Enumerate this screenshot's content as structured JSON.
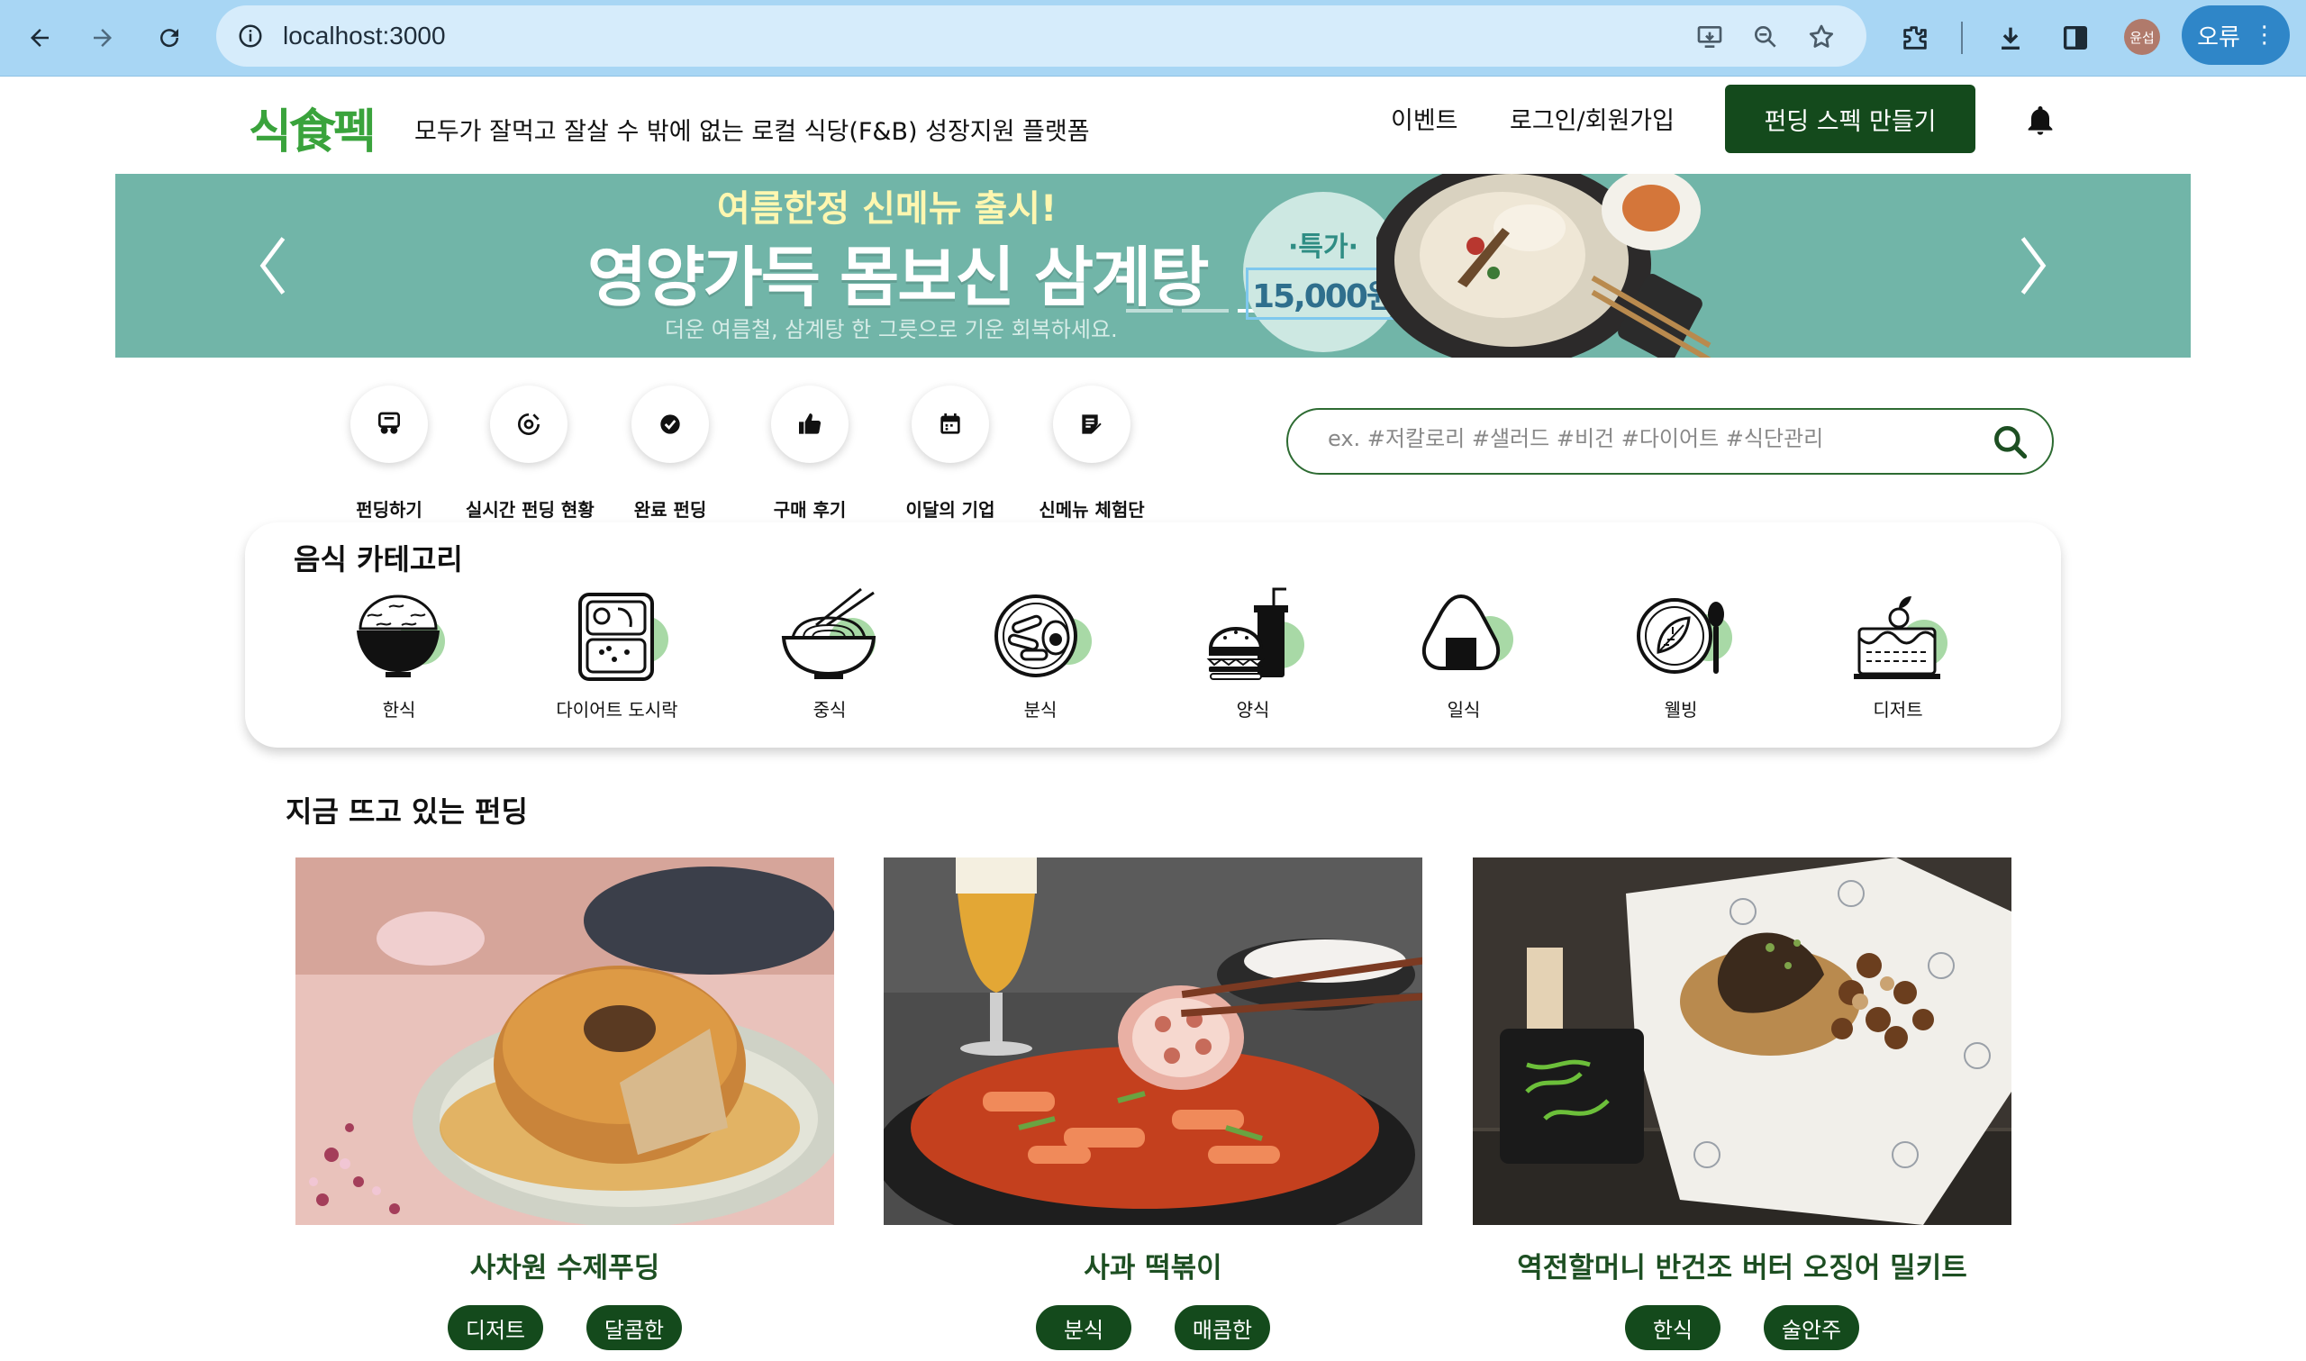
{
  "browser": {
    "url": "localhost:3000",
    "profile_initials": "윤섭",
    "error_label": "오류"
  },
  "header": {
    "logo": "식食펙",
    "tagline": "모두가 잘먹고 잘살 수 밖에 없는 로컬 식당(F&B) 성장지원 플랫폼",
    "nav": [
      "이벤트",
      "로그인/회원가입"
    ],
    "cta": "펀딩 스펙 만들기"
  },
  "banner": {
    "kicker": "여름한정 신메뉴 출시!",
    "title": "영양가득 몸보신 삼계탕",
    "subtitle": "더운 여름철, 삼계탕 한 그릇으로 기운 회복하세요.",
    "price_label": "·특가·",
    "price": "15,000원",
    "active_slide": 3,
    "slide_count": 3
  },
  "quick_menu": [
    {
      "label": "펀딩하기",
      "icon": "funding-icon"
    },
    {
      "label": "실시간 펀딩 현황",
      "icon": "live-status-icon"
    },
    {
      "label": "완료 펀딩",
      "icon": "check-circle-icon"
    },
    {
      "label": "구매 후기",
      "icon": "thumbs-up-icon"
    },
    {
      "label": "이달의 기업",
      "icon": "calendar-icon"
    },
    {
      "label": "신메뉴 체험단",
      "icon": "edit-note-icon"
    }
  ],
  "search": {
    "placeholder": "ex. #저칼로리 #샐러드 #비건 #다이어트 #식단관리"
  },
  "categories": {
    "title": "음식 카테고리",
    "items": [
      {
        "label": "한식",
        "icon": "rice-bowl-icon"
      },
      {
        "label": "다이어트 도시락",
        "icon": "lunchbox-icon"
      },
      {
        "label": "중식",
        "icon": "noodle-bowl-icon"
      },
      {
        "label": "분식",
        "icon": "snack-plate-icon"
      },
      {
        "label": "양식",
        "icon": "burger-drink-icon"
      },
      {
        "label": "일식",
        "icon": "onigiri-icon"
      },
      {
        "label": "웰빙",
        "icon": "salad-plate-icon"
      },
      {
        "label": "디저트",
        "icon": "cake-icon"
      }
    ],
    "accent_color": "#a8d9a6"
  },
  "trending": {
    "title": "지금 뜨고 있는 펀딩",
    "products": [
      {
        "name": "사차원 수제푸딩",
        "tags": [
          "디저트",
          "달콤한"
        ]
      },
      {
        "name": "사과 떡볶이",
        "tags": [
          "분식",
          "매콤한"
        ]
      },
      {
        "name": "역전할머니 반건조 버터 오징어 밀키트",
        "tags": [
          "한식",
          "술안주"
        ]
      }
    ]
  },
  "colors": {
    "brand_green": "#3aa33c",
    "dark_green": "#144a1c",
    "banner_teal": "#71b5a8",
    "chrome_blue": "#a8d6f4"
  }
}
